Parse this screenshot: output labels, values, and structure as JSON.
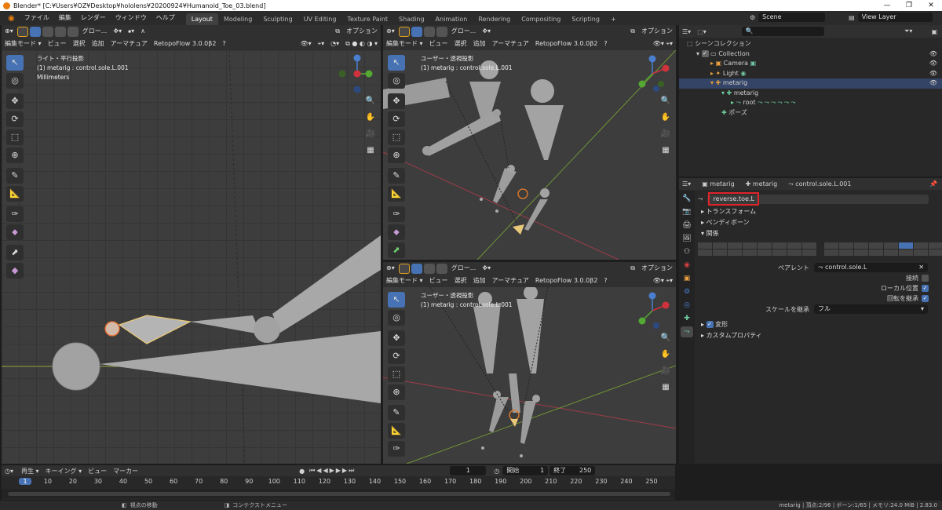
{
  "title_bar": {
    "text": "Blender* [C:¥Users¥OZ¥Desktop¥hololens¥20200924¥Humanoid_Toe_03.blend]"
  },
  "menu": {
    "items": [
      "ファイル",
      "編集",
      "レンダー",
      "ウィンドウ",
      "ヘルプ"
    ]
  },
  "workspaces": [
    {
      "label": "Layout",
      "active": true
    },
    {
      "label": "Modeling"
    },
    {
      "label": "Sculpting"
    },
    {
      "label": "UV Editing"
    },
    {
      "label": "Texture Paint"
    },
    {
      "label": "Shading"
    },
    {
      "label": "Animation"
    },
    {
      "label": "Rendering"
    },
    {
      "label": "Compositing"
    },
    {
      "label": "Scripting"
    }
  ],
  "scene": {
    "name": "Scene",
    "view_layer": "View Layer"
  },
  "viewport_header": {
    "transform": "グロー...",
    "mode": "編集モード",
    "menus": [
      "ビュー",
      "選択",
      "追加",
      "アーマチュア"
    ],
    "addon": "RetopoFlow 3.0.0β2",
    "options": "オプション"
  },
  "viewports": {
    "left": {
      "projection": "ライト・平行投影",
      "object": "(1) metarig : control.sole.L.001",
      "units": "Millimeters"
    },
    "top_right": {
      "projection": "ユーザー・透視投影",
      "object": "(1) metarig : control.sole.L.001"
    },
    "bottom_right": {
      "projection": "ユーザー・透視投影",
      "object": "(1) metarig : control.sole.L.001"
    }
  },
  "outliner": {
    "root": "シーンコレクション",
    "items": [
      "Collection",
      "Camera",
      "Light",
      "metarig",
      "metarig",
      "root",
      "ポーズ"
    ]
  },
  "properties": {
    "breadcrumb": [
      "metarig",
      "metarig",
      "control.sole.L.001"
    ],
    "bone_name": "reverse.toe.L",
    "sections": {
      "transform": "トランスフォーム",
      "bendy": "ベンディボーン",
      "relations": "関係",
      "deform": "変形",
      "custom": "カスタムプロパティ"
    },
    "parent_label": "ペアレント",
    "parent_value": "control.sole.L",
    "connected_label": "接続",
    "local_location_label": "ローカル位置",
    "inherit_rotation_label": "回転を継承",
    "inherit_scale_label": "スケールを継承",
    "inherit_scale_value": "フル"
  },
  "timeline": {
    "menus": [
      "再生",
      "キーイング",
      "ビュー",
      "マーカー"
    ],
    "current_frame": "1",
    "start_label": "開始",
    "start": "1",
    "end_label": "終了",
    "end": "250",
    "ticks": [
      "1",
      "10",
      "20",
      "30",
      "40",
      "50",
      "60",
      "70",
      "80",
      "90",
      "100",
      "110",
      "120",
      "130",
      "140",
      "150",
      "160",
      "170",
      "180",
      "190",
      "200",
      "210",
      "220",
      "230",
      "240",
      "250"
    ]
  },
  "statusbar": {
    "left": "視点の移動",
    "middle": "コンテクストメニュー",
    "right": "metarig | 頂点:2/96 | ボーン:1/65 | メモリ:24.0 MiB | 2.83.0"
  },
  "colors": {
    "accent": "#4772b3",
    "highlight_box": "#e0242a",
    "bone_gray": "#a8a8a8",
    "selected_bone": "#e8c87a"
  }
}
